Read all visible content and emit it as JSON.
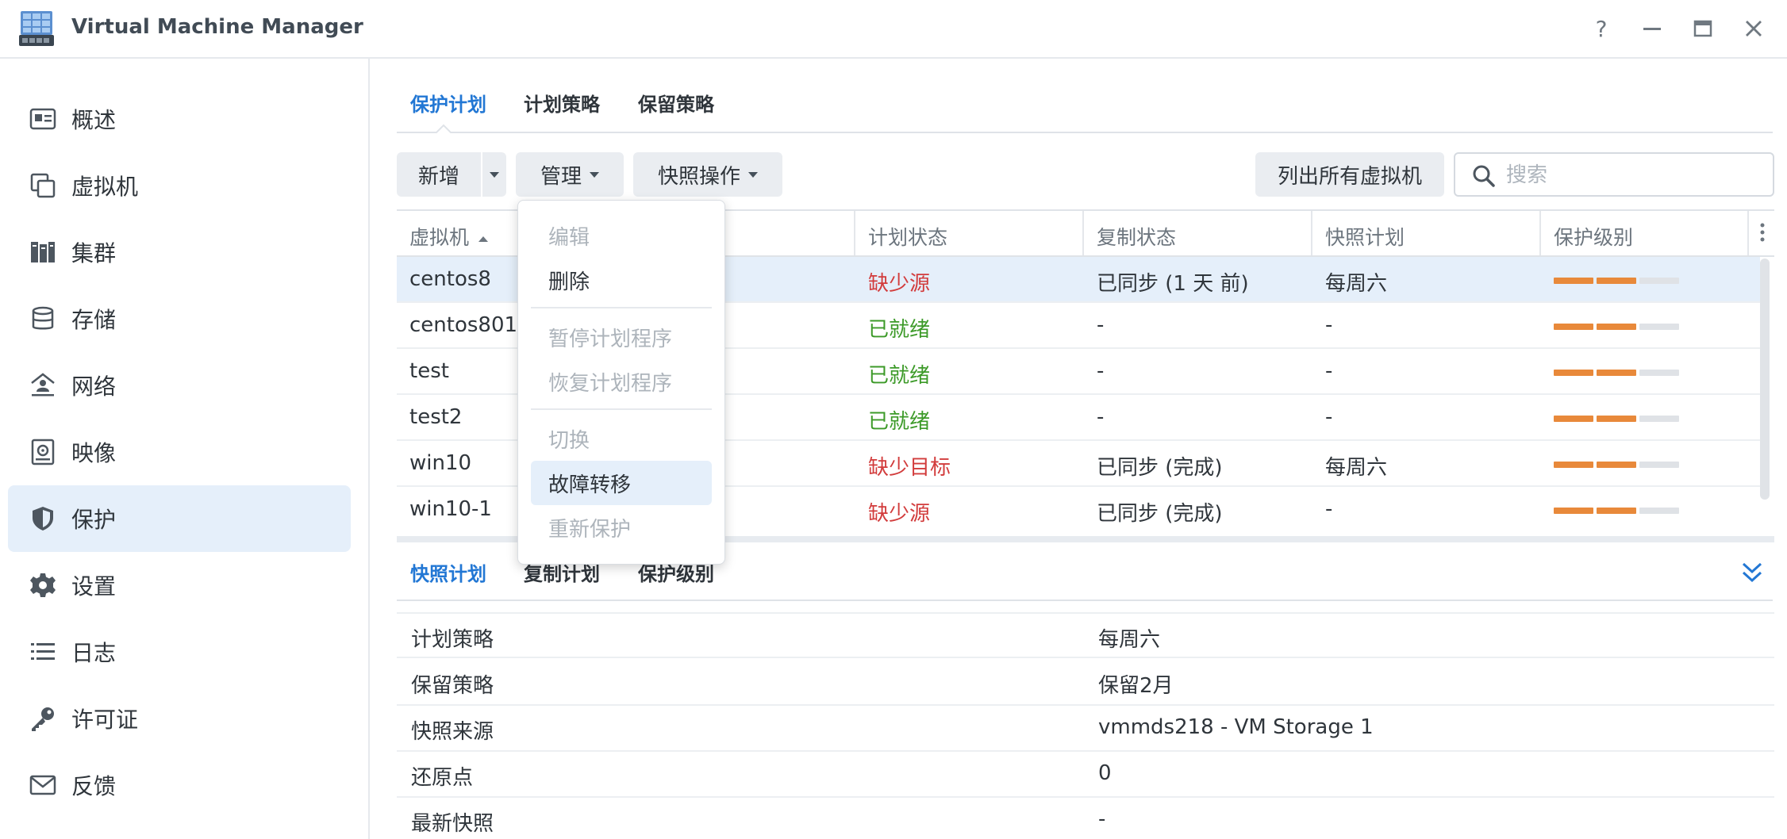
{
  "app": {
    "title": "Virtual Machine Manager"
  },
  "window_controls": {
    "help": "?",
    "minimize": "—",
    "maximize": "▭",
    "close": "✕"
  },
  "sidebar": {
    "items": [
      {
        "label": "概述",
        "icon": "overview-icon"
      },
      {
        "label": "虚拟机",
        "icon": "virtual-machine-icon"
      },
      {
        "label": "集群",
        "icon": "cluster-icon"
      },
      {
        "label": "存储",
        "icon": "storage-icon"
      },
      {
        "label": "网络",
        "icon": "network-icon"
      },
      {
        "label": "映像",
        "icon": "image-icon"
      },
      {
        "label": "保护",
        "icon": "shield-icon",
        "active": true
      },
      {
        "label": "设置",
        "icon": "gear-icon"
      },
      {
        "label": "日志",
        "icon": "log-list-icon"
      },
      {
        "label": "许可证",
        "icon": "key-icon"
      },
      {
        "label": "反馈",
        "icon": "mail-icon"
      }
    ]
  },
  "tabs": {
    "items": [
      "保护计划",
      "计划策略",
      "保留策略"
    ],
    "active": 0
  },
  "toolbar": {
    "add": "新增",
    "manage": "管理",
    "snapshot_ops": "快照操作",
    "list_all_vms": "列出所有虚拟机"
  },
  "search": {
    "placeholder": "搜索",
    "value": ""
  },
  "grid": {
    "columns": [
      "虚拟机",
      "计划状态",
      "复制状态",
      "快照计划",
      "保护级别"
    ],
    "sort_column": "虚拟机",
    "sort_direction": "ascending",
    "rows": [
      {
        "vm": "centos8",
        "plan_status": "缺少源",
        "status_color": "red",
        "replication": "已同步 (1 天 前)",
        "snapshot_plan": "每周六",
        "protection_level": 2,
        "selected": true
      },
      {
        "vm": "centos801",
        "plan_status": "已就绪",
        "status_color": "green",
        "replication": "-",
        "snapshot_plan": "-",
        "protection_level": 2
      },
      {
        "vm": "test",
        "plan_status": "已就绪",
        "status_color": "green",
        "replication": "-",
        "snapshot_plan": "-",
        "protection_level": 2
      },
      {
        "vm": "test2",
        "plan_status": "已就绪",
        "status_color": "green",
        "replication": "-",
        "snapshot_plan": "-",
        "protection_level": 2
      },
      {
        "vm": "win10",
        "plan_status": "缺少目标",
        "status_color": "red",
        "replication": "已同步 (完成)",
        "snapshot_plan": "每周六",
        "protection_level": 2
      },
      {
        "vm": "win10-1",
        "plan_status": "缺少源",
        "status_color": "red",
        "replication": "已同步 (完成)",
        "snapshot_plan": "-",
        "protection_level": 2
      }
    ],
    "protection_level_max": 3,
    "colors": {
      "level_on": "#e8893a",
      "level_off": "#dfe2e6"
    }
  },
  "manage_menu": {
    "items": [
      {
        "label": "编辑",
        "enabled": false
      },
      {
        "label": "删除",
        "enabled": true
      },
      {
        "label": "暂停计划程序",
        "enabled": false
      },
      {
        "label": "恢复计划程序",
        "enabled": false
      },
      {
        "label": "切换",
        "enabled": false
      },
      {
        "label": "故障转移",
        "enabled": true,
        "hovered": true
      },
      {
        "label": "重新保护",
        "enabled": false
      }
    ]
  },
  "detail": {
    "tabs": [
      "快照计划",
      "复制计划",
      "保护级别"
    ],
    "active_tab": 0,
    "rows": [
      {
        "key": "计划策略",
        "value": "每周六"
      },
      {
        "key": "保留策略",
        "value": "保留2月"
      },
      {
        "key": "快照来源",
        "value": "vmmds218 - VM Storage 1"
      },
      {
        "key": "还原点",
        "value": "0"
      },
      {
        "key": "最新快照",
        "value": "-"
      }
    ]
  },
  "colors": {
    "accent": "#2277d4",
    "error": "#d23c3c",
    "ok": "#3c9a28",
    "selected_bg": "#e5effa"
  }
}
